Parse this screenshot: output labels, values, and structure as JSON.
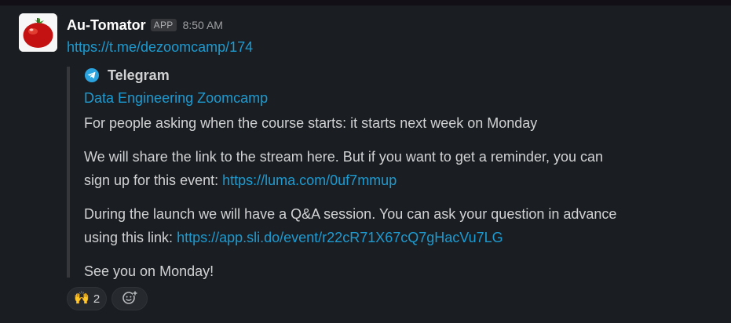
{
  "message": {
    "sender": "Au-Tomator",
    "badge": "APP",
    "time": "8:50 AM",
    "link": "https://t.me/dezoomcamp/174",
    "avatar_icon": "tomato-avatar"
  },
  "unfurl": {
    "service_name": "Telegram",
    "service_icon": "telegram-icon",
    "title": "Data Engineering Zoomcamp",
    "paragraphs": {
      "p1": "For people asking when the course starts: it starts next week on Monday",
      "p2_line1": "We will share the link to the stream here. But if you want to get a reminder, you can",
      "p2_line2_prefix": "sign up for this event: ",
      "p2_link": "https://luma.com/0uf7mmup",
      "p3_line1": "During the launch we will have a Q&A session. You can ask your question in advance",
      "p3_line2_prefix": "using this link: ",
      "p3_link": "https://app.sli.do/event/r22cR71X67cQ7gHacVu7LG",
      "p4": "See you on Monday!"
    }
  },
  "reactions": [
    {
      "emoji": "🙌",
      "count": "2"
    }
  ],
  "add_reaction_icon": "add-emoji-icon",
  "colors": {
    "background": "#1a1d21",
    "link": "#1d9bd1",
    "text": "#d1d2d3",
    "sender": "#ffffff"
  }
}
